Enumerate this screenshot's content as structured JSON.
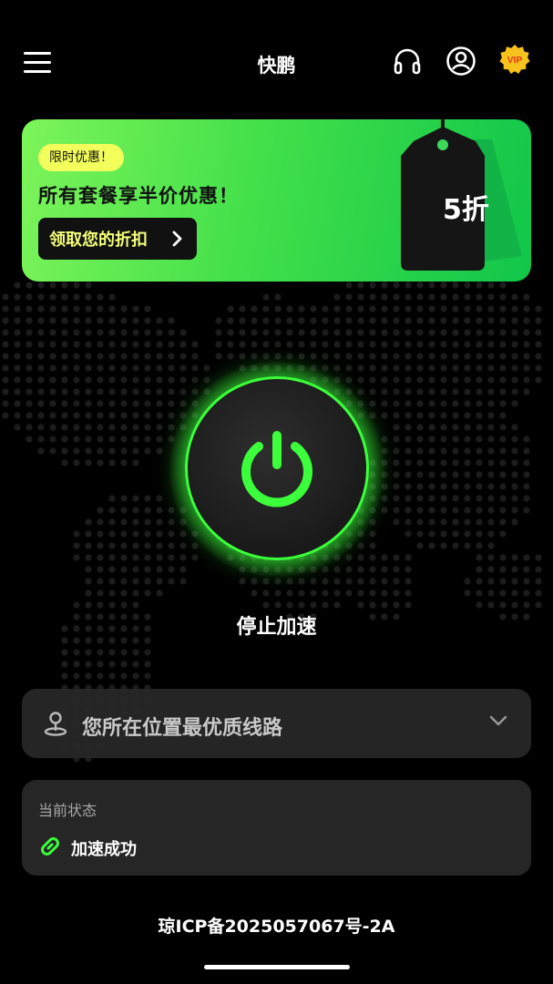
{
  "header": {
    "title": "快鹏",
    "menu_icon": "hamburger-menu-icon",
    "support_icon": "headset-icon",
    "profile_icon": "user-profile-icon",
    "vip_label": "VIP"
  },
  "promo": {
    "badge": "限时优惠！",
    "text": "所有套餐享半价优惠！",
    "button_label": "领取您的折扣",
    "tag_label": "5折"
  },
  "power": {
    "status_label": "停止加速",
    "icon": "power-icon",
    "color": "#3cff3c"
  },
  "location": {
    "label": "您所在位置最优质线路",
    "icon": "location-pin-icon"
  },
  "status_card": {
    "title": "当前状态",
    "value": "加速成功",
    "icon": "link-icon"
  },
  "footer": {
    "icp": "琼ICP备2025057067号-2A"
  }
}
